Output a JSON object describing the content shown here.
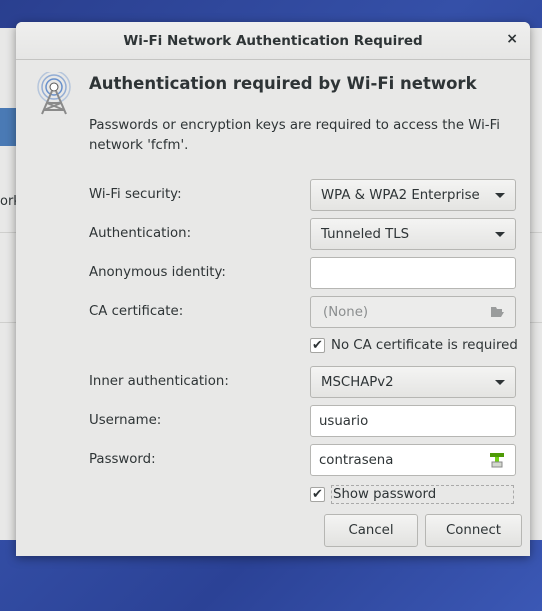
{
  "background": {
    "partial_text": "ork"
  },
  "dialog": {
    "title": "Wi-Fi Network Authentication Required",
    "heading": "Authentication required by Wi-Fi network",
    "description": "Passwords or encryption keys are required to access the Wi-Fi network 'fcfm'.",
    "fields": {
      "wifi_security": {
        "label": "Wi-Fi security:",
        "value": "WPA & WPA2 Enterprise"
      },
      "authentication": {
        "label": "Authentication:",
        "value": "Tunneled TLS"
      },
      "anonymous_identity": {
        "label": "Anonymous identity:",
        "value": ""
      },
      "ca_certificate": {
        "label": "CA certificate:",
        "value": "(None)"
      },
      "no_ca_required": {
        "label": "No CA certificate is required",
        "checked": true
      },
      "inner_auth": {
        "label": "Inner authentication:",
        "value": "MSCHAPv2"
      },
      "username": {
        "label": "Username:",
        "value": "usuario"
      },
      "password": {
        "label": "Password:",
        "value": "contrasena"
      },
      "show_password": {
        "label": "Show password",
        "checked": true
      }
    },
    "buttons": {
      "cancel": "Cancel",
      "connect": "Connect"
    },
    "check_mark": "✔",
    "close_glyph": "×"
  }
}
